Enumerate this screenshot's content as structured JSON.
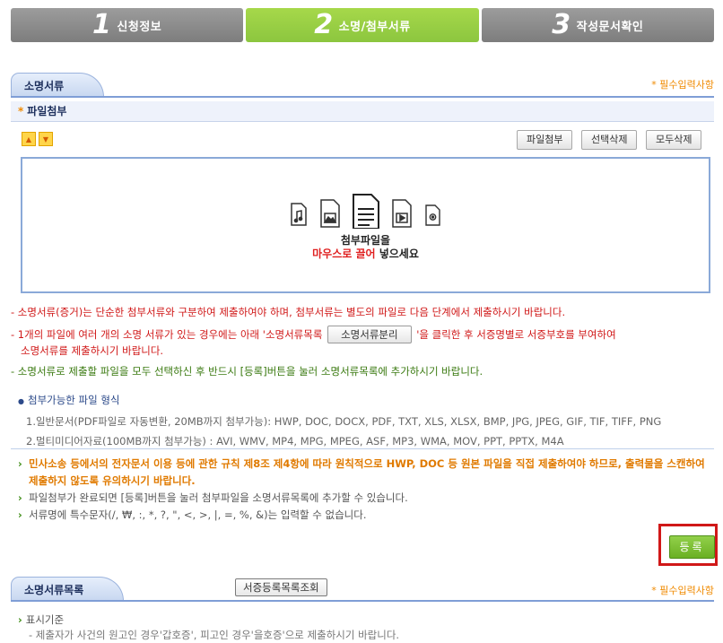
{
  "steps": [
    {
      "num": "1",
      "label": "신청정보"
    },
    {
      "num": "2",
      "label": "소명/첨부서류"
    },
    {
      "num": "3",
      "label": "작성문서확인"
    }
  ],
  "section1": {
    "title": "소명서류",
    "required": "필수입력사항",
    "subhead": "파일첨부"
  },
  "toolbar": {
    "attach": "파일첨부",
    "delete_selected": "선택삭제",
    "delete_all": "모두삭제"
  },
  "dropzone": {
    "line1": "첨부파일을",
    "line2_red": "마우스로 끌어",
    "line2_rest": " 넣으세요"
  },
  "notices": {
    "n1": "- 소명서류(증거)는 단순한 첨부서류와 구분하여 제출하여야 하며, 첨부서류는 별도의 파일로 다음 단계에서 제출하시기 바랍니다.",
    "n2a": "- 1개의 파일에 여러 개의 소명 서류가 있는 경우에는 아래 '소명서류목록",
    "n2_btn": "소명서류분리",
    "n2b": "'을 클릭한 후 서증명별로 서증부호를 부여하여",
    "n2c": "소명서류를 제출하시기 바랍니다.",
    "n3": "- 소명서류로 제출할 파일을 모두 선택하신 후 반드시 [등록]버튼을 눌러 소명서류목록에 추가하시기 바랍니다."
  },
  "formats": {
    "title": "첨부가능한 파일 형식",
    "general": "1.일반문서(PDF파일로 자동변환, 20MB까지 첨부가능): HWP, DOC, DOCX, PDF, TXT, XLS, XLSX, BMP, JPG, JPEG, GIF, TIF, TIFF, PNG",
    "multimedia": "2.멀티미디어자료(100MB까지 첨부가능) : AVI, WMV, MP4, MPG, MPEG, ASF, MP3, WMA, MOV, PPT, PPTX, M4A"
  },
  "bullets": {
    "b1": "민사소송 등에서의 전자문서 이용 등에 관한 규칙 제8조 제4항에 따라 원칙적으로 HWP, DOC 등 원본 파일을 직접 제출하여야 하므로, 출력물을 스캔하여 제출하지 않도록 유의하시기 바랍니다.",
    "b2": "파일첨부가 완료되면 [등록]버튼을 눌러 첨부파일을 소명서류목록에 추가할 수 있습니다.",
    "b3": "서류명에 특수문자(/, ₩, :, *, ?, \", <, >, |, =, %, &)는 입력할 수 없습니다."
  },
  "register": "등록",
  "section2": {
    "title": "소명서류목록",
    "search_button": "서증등록목록조회",
    "required": "필수입력사항"
  },
  "bottom": {
    "label": "표시기준",
    "sub": "- 제출자가 사건의 원고인 경우'갑호증', 피고인 경우'을호증'으로 제출하시기 바랍니다."
  },
  "colors": {
    "active_step": "#8cc63f",
    "inactive_step": "#8a8a8a",
    "required": "#f08a00",
    "warning": "#d01818"
  },
  "icons": [
    "music-file-icon",
    "image-file-icon",
    "document-file-icon",
    "video-file-icon",
    "settings-file-icon",
    "arrow-up-icon",
    "arrow-down-icon"
  ]
}
